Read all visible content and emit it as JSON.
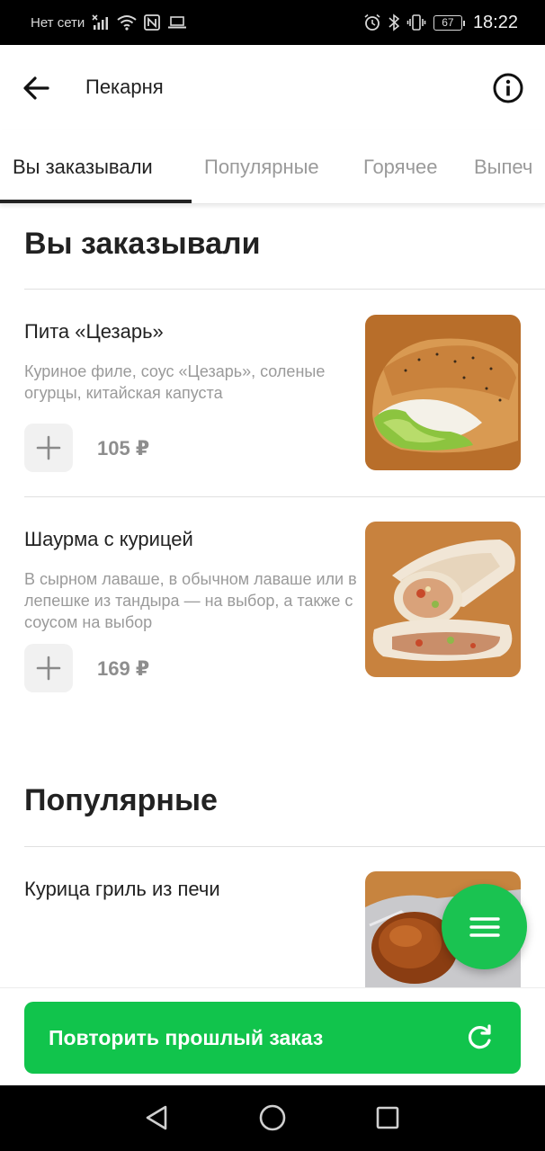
{
  "status_bar": {
    "carrier": "Нет сети",
    "battery": "67",
    "time": "18:22",
    "left_icons": [
      "signal-off-icon",
      "wifi-icon",
      "nfc-icon",
      "laptop-icon"
    ],
    "right_icons": [
      "alarm-icon",
      "bluetooth-icon",
      "vibrate-icon",
      "battery-icon"
    ]
  },
  "header": {
    "title": "Пекарня",
    "back_icon": "arrow-left-icon",
    "info_icon": "info-circle-icon"
  },
  "tabs": [
    {
      "label": "Вы заказывали",
      "active": true
    },
    {
      "label": "Популярные",
      "active": false
    },
    {
      "label": "Горячее",
      "active": false
    },
    {
      "label": "Выпеч",
      "active": false
    }
  ],
  "sections": [
    {
      "title": "Вы заказывали",
      "items": [
        {
          "name": "Пита «Цезарь»",
          "description": "Куриное филе, соус «Цезарь», соленые огурцы, китайская капуста",
          "price": "105 ₽",
          "image": "pita-caesar-photo"
        },
        {
          "name": "Шаурма с курицей",
          "description": "В сырном лаваше, в обычном лаваше или в лепешке из тандыра — на выбор, а также с соусом на выбор",
          "price": "169 ₽",
          "image": "chicken-shawarma-photo"
        }
      ]
    },
    {
      "title": "Популярные",
      "items": [
        {
          "name": "Курица гриль из печи",
          "image": "grilled-chicken-photo"
        }
      ]
    }
  ],
  "fab": {
    "icon": "menu-lines-icon"
  },
  "bottom": {
    "repeat_label": "Повторить прошлый заказ",
    "repeat_icon": "refresh-icon"
  },
  "colors": {
    "accent": "#11c44c",
    "fab": "#1ac351",
    "muted_text": "#9a9a9a",
    "price_text": "#8e8e8e"
  }
}
